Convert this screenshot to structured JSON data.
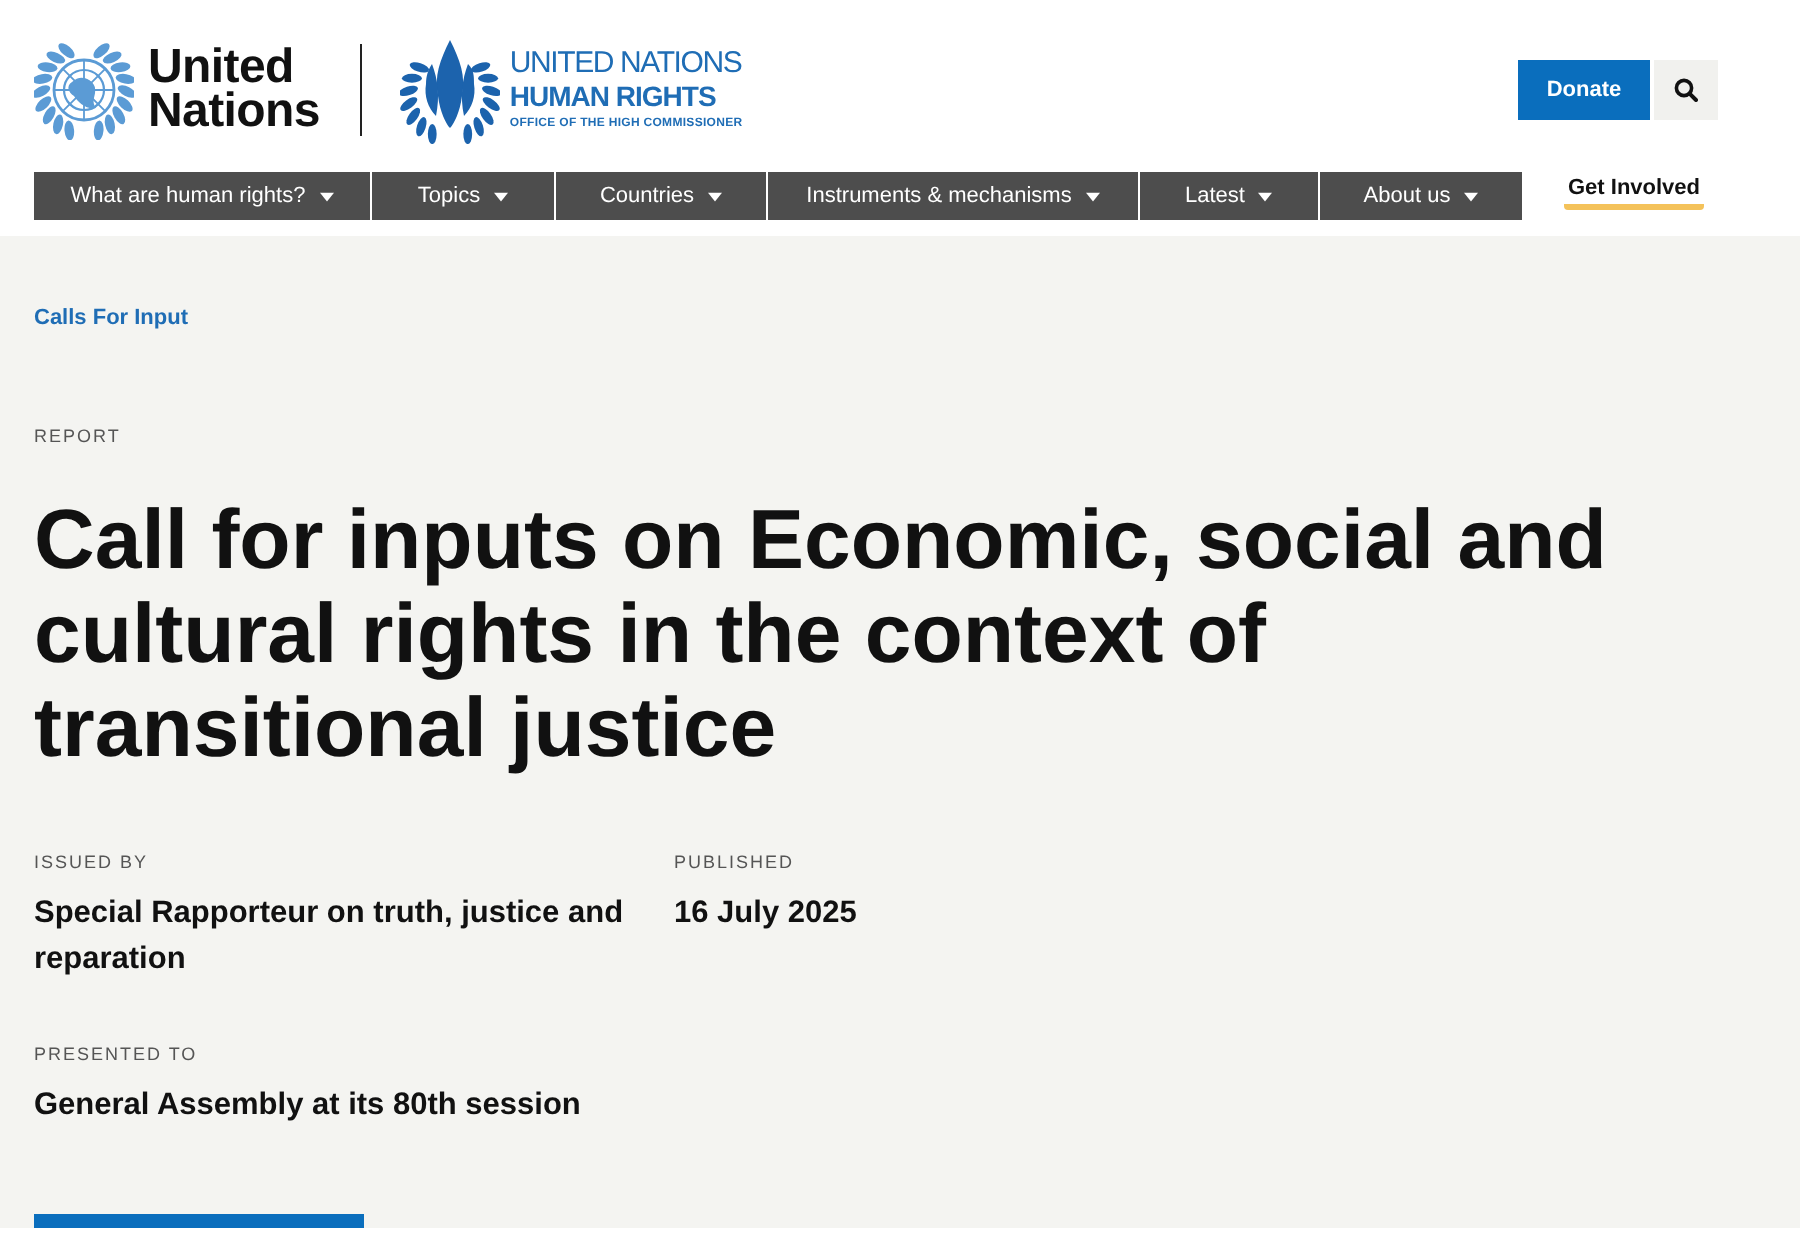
{
  "header": {
    "un_logo": {
      "wordmark": "United Nations"
    },
    "ohchr_logo": {
      "line_1": "UNITED NATIONS",
      "line_2": "HUMAN RIGHTS",
      "line_3": "OFFICE OF THE HIGH COMMISSIONER"
    },
    "donate_button": {
      "label": "Donate"
    }
  },
  "nav": {
    "items": [
      {
        "label": "What are human rights?",
        "kind": "dropdown"
      },
      {
        "label": "Topics",
        "kind": "dropdown"
      },
      {
        "label": "Countries",
        "kind": "dropdown"
      },
      {
        "label": "Instruments & mechanisms",
        "kind": "dropdown"
      },
      {
        "label": "Latest",
        "kind": "dropdown"
      },
      {
        "label": "About us",
        "kind": "dropdown"
      },
      {
        "label": "Get Involved",
        "kind": "highlight"
      }
    ]
  },
  "page": {
    "breadcrumb": "Calls For Input",
    "type": "REPORT",
    "title": "Call for inputs on Economic, social and cultural rights in the context of transitional justice",
    "meta": [
      {
        "label": "ISSUED BY",
        "value": "Special Rapporteur on truth, justice and reparation"
      },
      {
        "label": "PUBLISHED",
        "value": "16 July 2025"
      },
      {
        "label": "PRESENTED TO",
        "value": "General Assembly at its 80th session"
      }
    ]
  }
}
